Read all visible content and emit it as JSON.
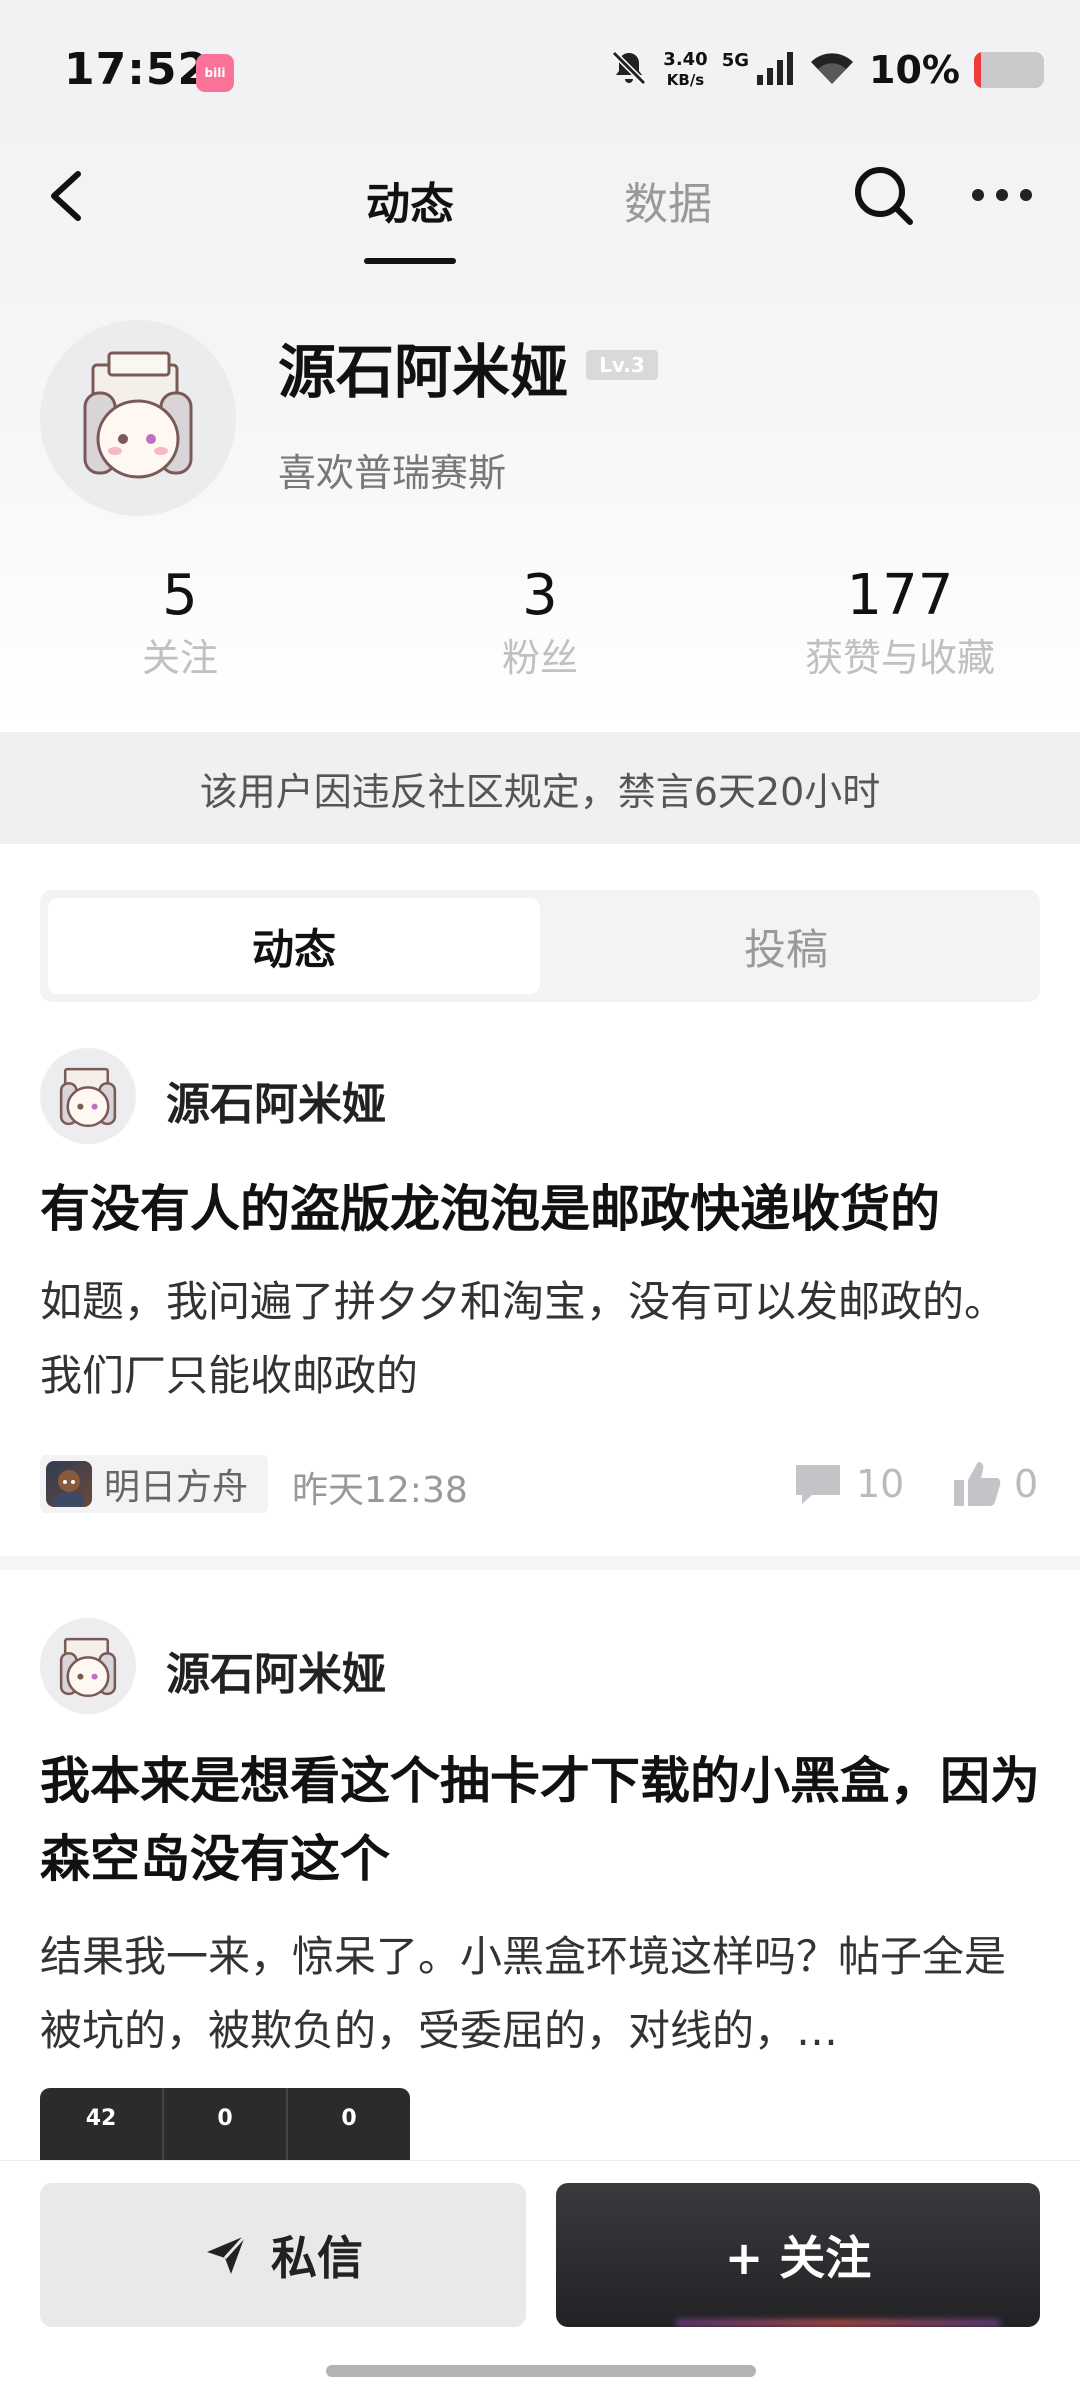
{
  "status_bar": {
    "time": "17:52",
    "app_icon_text": "bili",
    "net_speed_value": "3.40",
    "net_speed_unit": "KB/s",
    "signal_label": "5G",
    "battery_text": "10%",
    "battery_level": 0.1,
    "icons": [
      "mute-bell-icon",
      "signal-icon",
      "wifi-icon",
      "battery-icon"
    ]
  },
  "nav": {
    "tabs": [
      {
        "label": "动态",
        "active": true
      },
      {
        "label": "数据",
        "active": false
      }
    ]
  },
  "profile": {
    "name": "源石阿米娅",
    "level": "Lv.3",
    "bio": "喜欢普瑞赛斯",
    "stats": [
      {
        "value": "5",
        "label": "关注"
      },
      {
        "value": "3",
        "label": "粉丝"
      },
      {
        "value": "177",
        "label": "获赞与收藏"
      }
    ]
  },
  "ban_notice": "该用户因违反社区规定，禁言6天20小时",
  "content_tabs": [
    {
      "label": "动态",
      "active": true
    },
    {
      "label": "投稿",
      "active": false
    }
  ],
  "posts": [
    {
      "author": "源石阿米娅",
      "title": "有没有人的盗版龙泡泡是邮政快递收货的",
      "body": "如题，我问遍了拼夕夕和淘宝，没有可以发邮政的。我们厂只能收邮政的",
      "game_tag": "明日方舟",
      "time": "昨天12:38",
      "comments": "10",
      "likes": "0"
    },
    {
      "author": "源石阿米娅",
      "title": "我本来是想看这个抽卡才下载的小黑盒，因为森空岛没有这个",
      "body": "结果我一来，惊呆了。小黑盒环境这样吗？帖子全是被坑的，被欺负的，受委屈的，对线的，…",
      "thumb_numbers": [
        "42",
        "0",
        "0"
      ]
    }
  ],
  "bottom": {
    "message_label": "私信",
    "follow_label": "+ 关注"
  },
  "colors": {
    "accent_dark": "#222225",
    "battery_low": "#ee3b3b",
    "bili_pink": "#fb7299"
  }
}
